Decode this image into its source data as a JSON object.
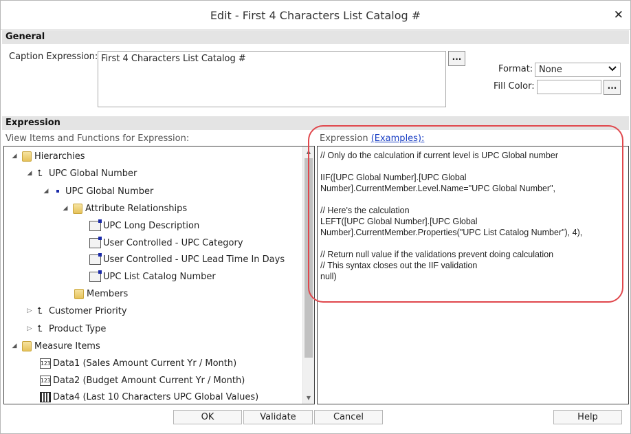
{
  "title": "Edit - First 4 Characters List Catalog #",
  "close_glyph": "✕",
  "general": {
    "header": "General",
    "caption_label": "Caption Expression:",
    "caption_value": "First 4 Characters List Catalog #",
    "ellipsis": "...",
    "format_label": "Format:",
    "format_value": "None",
    "fill_label": "Fill Color:",
    "fill_value": ""
  },
  "expression": {
    "header": "Expression",
    "view_label": "View Items and Functions for Expression:",
    "expr_label": "Expression ",
    "examples_link": "(Examples):",
    "code": "// Only do the calculation if current level is UPC Global number\n\nIIF([UPC Global Number].[UPC Global Number].CurrentMember.Level.Name=\"UPC Global Number\",\n\n// Here's the calculation\nLEFT([UPC Global Number].[UPC Global Number].CurrentMember.Properties(\"UPC List Catalog Number\"), 4),\n\n// Return null value if the validations prevent doing calculation\n// This syntax closes out the IIF validation\nnull)"
  },
  "tree": {
    "hierarchies": "Hierarchies",
    "upc_global_number": "UPC Global Number",
    "upc_global_number_level": "UPC Global Number",
    "attribute_relationships": "Attribute Relationships",
    "attr_items": [
      "UPC Long Description",
      "User Controlled - UPC Category",
      "User Controlled - UPC Lead Time In Days",
      "UPC List Catalog Number"
    ],
    "members": "Members",
    "customer_priority": "Customer Priority",
    "product_type": "Product Type",
    "measure_items": "Measure Items",
    "measures": [
      {
        "label": "Data1 (Sales Amount Current Yr / Month)",
        "icon": "123-icon"
      },
      {
        "label": "Data2 (Budget Amount Current Yr / Month)",
        "icon": "123-icon"
      },
      {
        "label": "Data4 (Last 10 Characters UPC Global Values)",
        "icon": "calculator-icon"
      }
    ],
    "icon_123_text": "123"
  },
  "buttons": {
    "ok": "OK",
    "validate": "Validate",
    "cancel": "Cancel",
    "help": "Help"
  },
  "colors": {
    "highlight": "#e0474c",
    "link": "#1a3fc4",
    "section_bg": "#e4e4e4"
  }
}
